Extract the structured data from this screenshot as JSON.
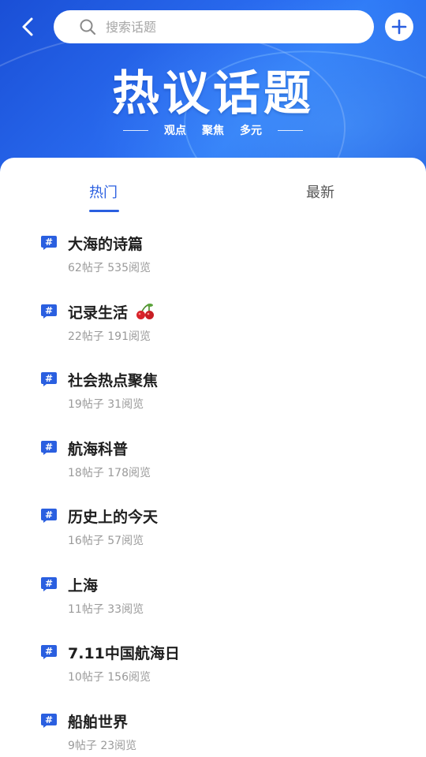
{
  "header": {
    "search_placeholder": "搜索话题"
  },
  "banner": {
    "title": "热议话题",
    "subtitle_words": [
      "观点",
      "聚焦",
      "多元"
    ]
  },
  "tabs": [
    {
      "label": "热门",
      "active": true
    },
    {
      "label": "最新",
      "active": false
    }
  ],
  "colors": {
    "accent": "#2a5fe0",
    "banner": "#2a6cf0"
  },
  "topics": [
    {
      "title": "大海的诗篇",
      "stats": "62帖子 535阅览"
    },
    {
      "title": "记录生活",
      "stats": "22帖子 191阅览",
      "emoji": "cherry-icon"
    },
    {
      "title": "社会热点聚焦",
      "stats": "19帖子 31阅览"
    },
    {
      "title": "航海科普",
      "stats": "18帖子 178阅览"
    },
    {
      "title": "历史上的今天",
      "stats": "16帖子 57阅览"
    },
    {
      "title": "上海",
      "stats": "11帖子 33阅览"
    },
    {
      "title": "7.11中国航海日",
      "stats": "10帖子 156阅览"
    },
    {
      "title": "船舶世界",
      "stats": "9帖子 23阅览"
    }
  ]
}
